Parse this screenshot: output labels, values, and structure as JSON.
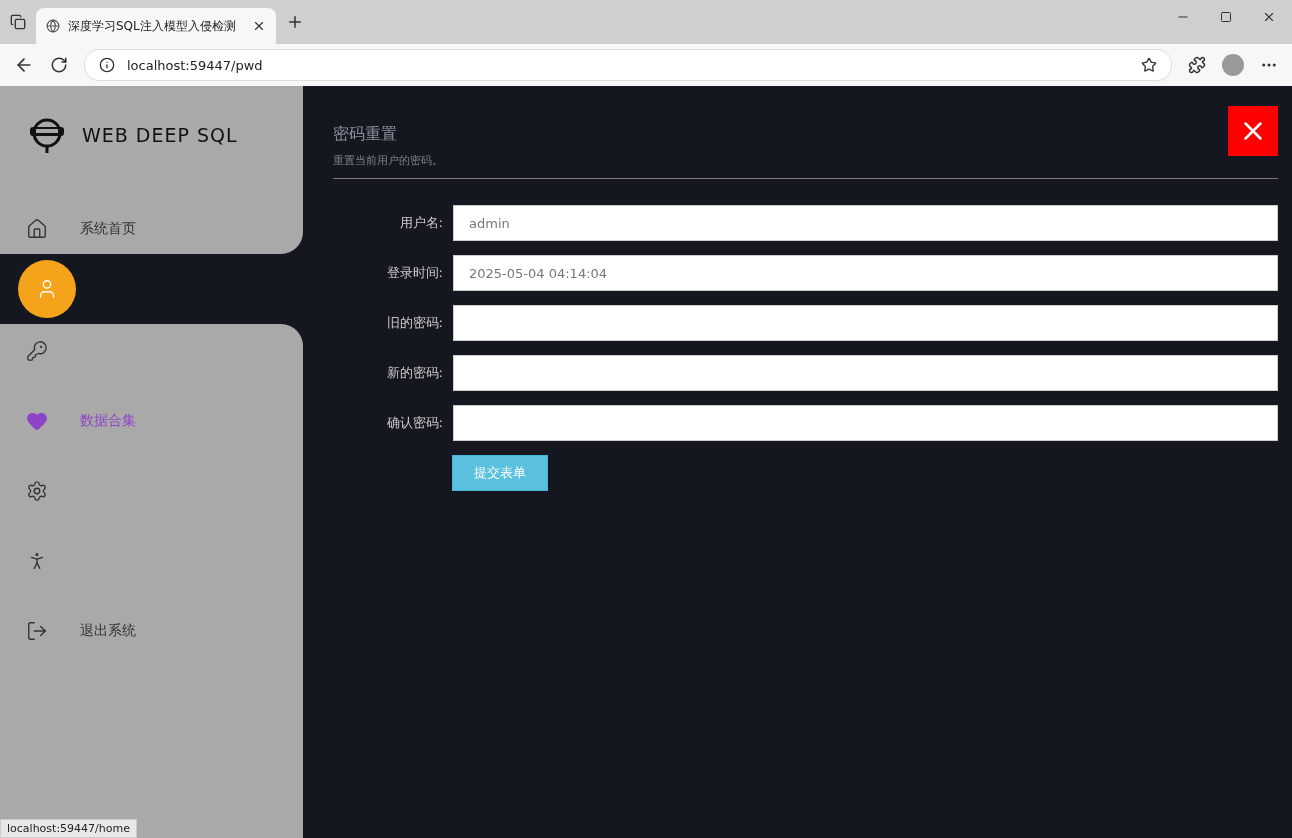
{
  "browser": {
    "tab_title": "深度学习SQL注入模型入侵检测",
    "address": "localhost:59447/pwd",
    "status_url": "localhost:59447/home"
  },
  "sidebar": {
    "brand": "WEB DEEP SQL",
    "items": [
      {
        "kind": "home",
        "label": "系统首页",
        "selected": false
      },
      {
        "kind": "user",
        "selected": true
      },
      {
        "kind": "key",
        "selected": false
      },
      {
        "kind": "heart",
        "label": "数据合集",
        "selected": false
      },
      {
        "kind": "gear",
        "selected": false
      },
      {
        "kind": "person",
        "selected": false
      },
      {
        "kind": "logout",
        "label": "退出系统",
        "selected": false
      }
    ]
  },
  "form": {
    "title": "密码重置",
    "subtitle": "重置当前用户的密码。",
    "fields": [
      {
        "label": "用户名:",
        "value": "admin"
      },
      {
        "label": "登录时间:",
        "value": "2025-05-04 04:14:04"
      },
      {
        "label": "旧的密码:"
      },
      {
        "label": "新的密码:"
      },
      {
        "label": "确认密码:"
      }
    ],
    "submit": "提交表单"
  }
}
